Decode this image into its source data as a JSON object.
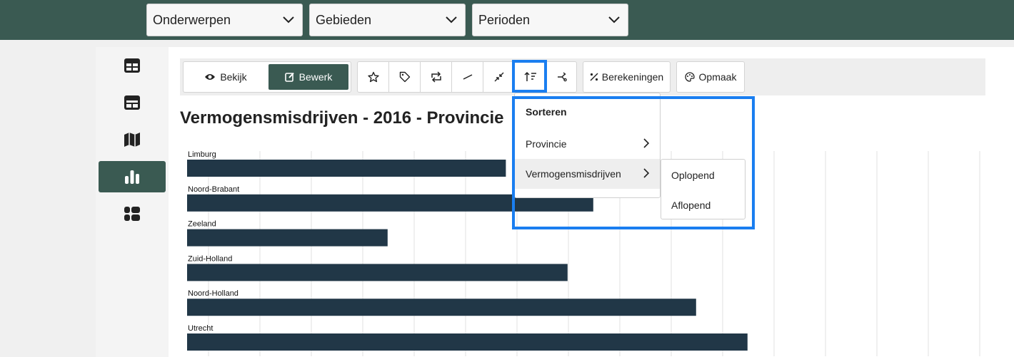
{
  "filters": [
    {
      "label": "Onderwerpen"
    },
    {
      "label": "Gebieden"
    },
    {
      "label": "Perioden"
    }
  ],
  "sidebar": {
    "items": [
      {
        "icon": "table-icon"
      },
      {
        "icon": "dashboard-icon"
      },
      {
        "icon": "map-icon"
      },
      {
        "icon": "bar-chart-icon",
        "active": true
      },
      {
        "icon": "grid-icon"
      }
    ]
  },
  "toolbar": {
    "bekijk_label": "Bekijk",
    "bewerk_label": "Bewerk",
    "icons": [
      "star-icon",
      "tag-icon",
      "swap-icon",
      "line-icon",
      "collapse-icon",
      "sort-icon",
      "share-icon"
    ],
    "berekeningen_label": "Berekeningen",
    "opmaak_label": "Opmaak"
  },
  "main": {
    "title": "Vermogensmisdrijven - 2016 - Provincie"
  },
  "sort_menu": {
    "header": "Sorteren",
    "items": [
      {
        "label": "Provincie"
      },
      {
        "label": "Vermogensmisdrijven"
      }
    ],
    "submenu": [
      "Oplopend",
      "Aflopend"
    ]
  },
  "chart_data": {
    "type": "bar",
    "orientation": "horizontal",
    "categories": [
      "Limburg",
      "Noord-Brabant",
      "Zeeland",
      "Zuid-Holland",
      "Noord-Holland",
      "Utrecht"
    ],
    "values": [
      0.62,
      0.79,
      0.39,
      0.74,
      0.99,
      1.09
    ],
    "bar_color": "#213747",
    "grid": true
  }
}
